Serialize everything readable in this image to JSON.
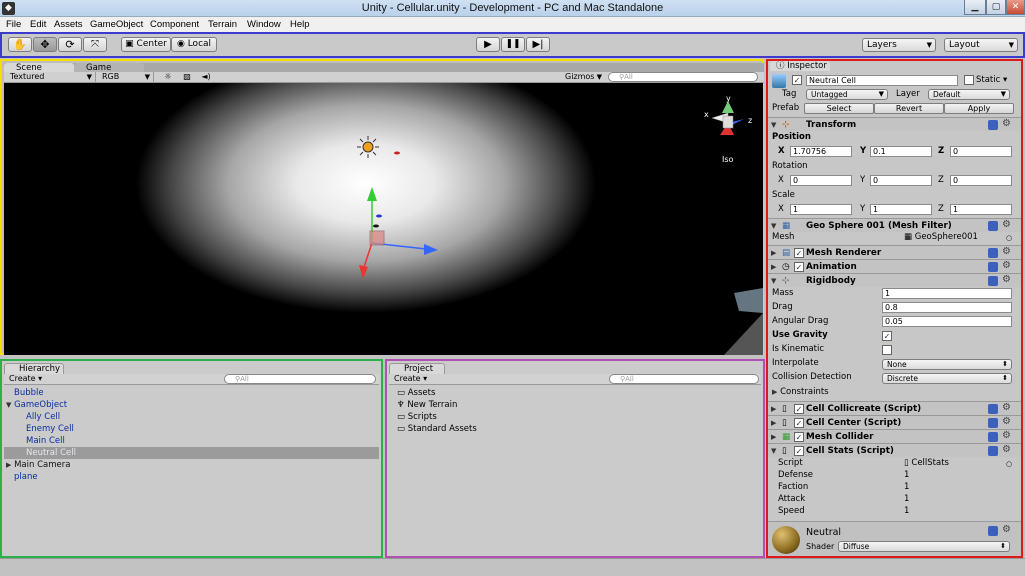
{
  "window": {
    "title": "Unity - Cellular.unity - Development - PC and Mac Standalone",
    "min": "▁",
    "max": "▢",
    "close": "✕"
  },
  "menu": [
    "File",
    "Edit",
    "Assets",
    "GameObject",
    "Component",
    "Terrain",
    "Window",
    "Help"
  ],
  "toolbar": {
    "center": "Center",
    "local": "Local",
    "layers": "Layers",
    "layout": "Layout"
  },
  "scene": {
    "tab_scene": "Scene",
    "tab_game": "Game",
    "render_mode": "Textured",
    "color_mode": "RGB",
    "gizmos": "Gizmos",
    "search": "All",
    "iso": "Iso",
    "axis_x": "x",
    "axis_y": "y",
    "axis_z": "z"
  },
  "hierarchy": {
    "tab": "Hierarchy",
    "create": "Create",
    "search": "All",
    "items": [
      "Bubble",
      "GameObject",
      "Ally Cell",
      "Enemy Cell",
      "Main Cell",
      "Neutral Cell",
      "Main Camera",
      "plane"
    ]
  },
  "project": {
    "tab": "Project",
    "create": "Create",
    "search": "All",
    "items": [
      "Assets",
      "New Terrain",
      "Scripts",
      "Standard Assets"
    ]
  },
  "inspector": {
    "tab": "Inspector",
    "object_name": "Neutral Cell",
    "static": "Static",
    "tag_label": "Tag",
    "tag": "Untagged",
    "layer_label": "Layer",
    "layer": "Default",
    "prefab_label": "Prefab",
    "select": "Select",
    "revert": "Revert",
    "apply": "Apply",
    "transform": {
      "title": "Transform",
      "position": "Position",
      "rotation": "Rotation",
      "scale": "Scale",
      "X": "X",
      "Y": "Y",
      "Z": "Z",
      "pos": [
        "1.70756",
        "0.1",
        "0"
      ],
      "rot": [
        "0",
        "0",
        "0"
      ],
      "scl": [
        "1",
        "1",
        "1"
      ]
    },
    "mesh_filter": {
      "title": "Geo Sphere 001 (Mesh Filter)",
      "mesh_label": "Mesh",
      "mesh": "GeoSphere001"
    },
    "mesh_renderer": "Mesh Renderer",
    "animation": "Animation",
    "rigidbody": {
      "title": "Rigidbody",
      "mass_label": "Mass",
      "mass": "1",
      "drag_label": "Drag",
      "drag": "0.8",
      "ang_label": "Angular Drag",
      "ang": "0.05",
      "gravity": "Use Gravity",
      "kinematic": "Is Kinematic",
      "interp_label": "Interpolate",
      "interp": "None",
      "coll_label": "Collision Detection",
      "coll": "Discrete",
      "constraints": "Constraints"
    },
    "cell_collicreate": "Cell Collicreate (Script)",
    "cell_center": "Cell Center (Script)",
    "mesh_collider": "Mesh Collider",
    "cell_stats": {
      "title": "Cell Stats (Script)",
      "script_label": "Script",
      "script": "CellStats",
      "defense_label": "Defense",
      "defense": "1",
      "faction_label": "Faction",
      "faction": "1",
      "attack_label": "Attack",
      "attack": "1",
      "speed_label": "Speed",
      "speed": "1"
    },
    "material": {
      "name": "Neutral",
      "shader_label": "Shader",
      "shader": "Diffuse"
    }
  }
}
